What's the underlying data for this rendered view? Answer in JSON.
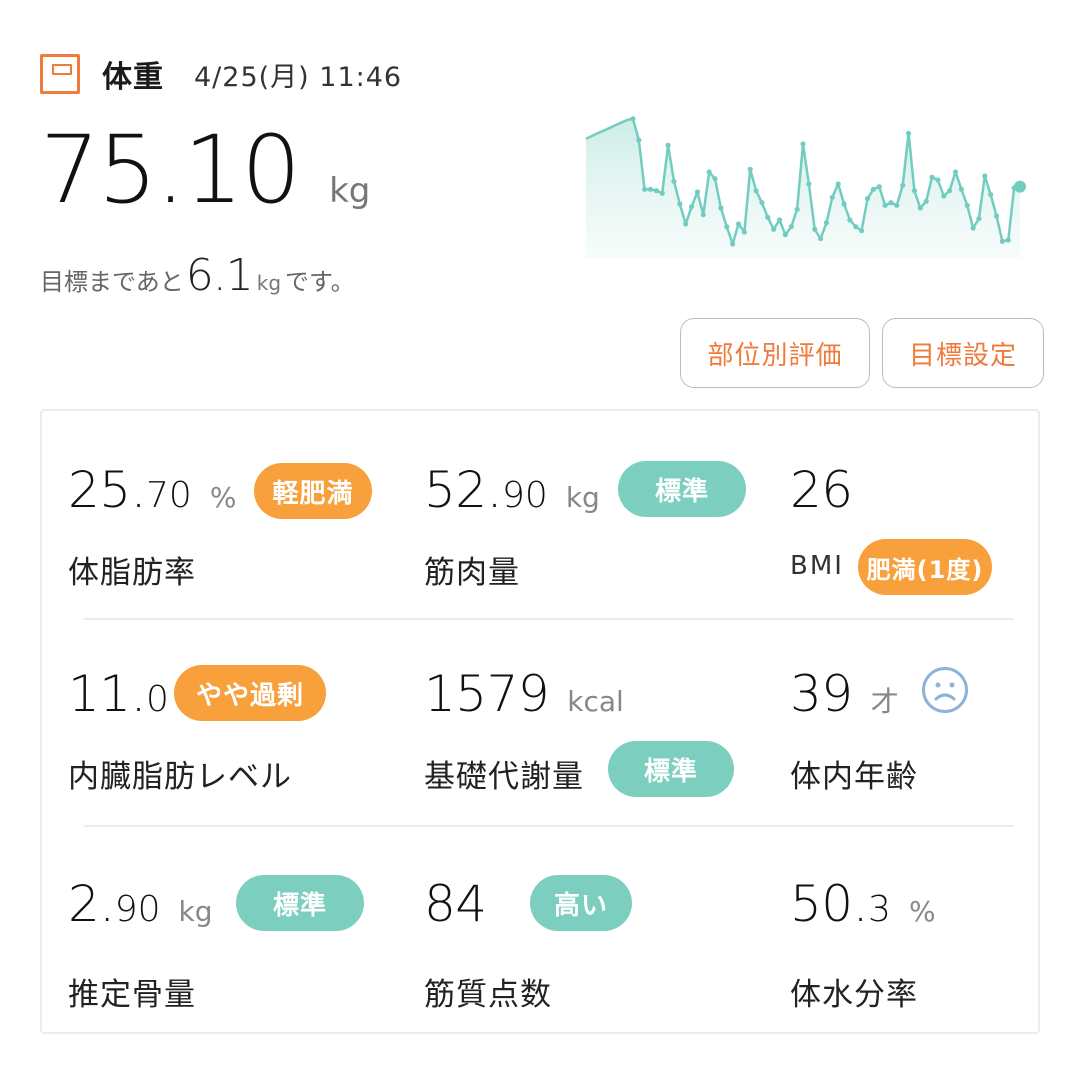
{
  "header": {
    "title": "体重",
    "date": "4/25(月) 11:46"
  },
  "weight": {
    "value": "75.10",
    "unit": "kg"
  },
  "goal": {
    "prefix": "目標まであと",
    "value": "6.1",
    "unit": "kg",
    "suffix": "です。"
  },
  "buttons": {
    "part_eval": "部位別評価",
    "goal_setting": "目標設定"
  },
  "colors": {
    "accent": "#f07a3a",
    "orange_badge": "#f7a03c",
    "teal_badge": "#7ccfbf",
    "line": "#72cdc0"
  },
  "metrics": [
    {
      "main": "25.",
      "dec": "70",
      "unit": "%",
      "label": "体脂肪率",
      "badge": "軽肥満",
      "badge_color": "orange"
    },
    {
      "main": "52.",
      "dec": "90",
      "unit": "kg",
      "label": "筋肉量",
      "badge": "標準",
      "badge_color": "teal"
    },
    {
      "main": "26",
      "dec": "",
      "unit": "",
      "label": "BMI",
      "badge": "肥満(1度)",
      "badge_color": "orange"
    },
    {
      "main": "11.",
      "dec": "0",
      "unit": "",
      "label": "内臓脂肪レベル",
      "badge": "やや過剰",
      "badge_color": "orange"
    },
    {
      "main": "1579",
      "dec": "",
      "unit": "kcal",
      "label": "基礎代謝量",
      "badge": "標準",
      "badge_color": "teal"
    },
    {
      "main": "39",
      "dec": "",
      "unit": "才",
      "label": "体内年齢",
      "icon": "sad-face-icon"
    },
    {
      "main": "2.",
      "dec": "90",
      "unit": "kg",
      "label": "推定骨量",
      "badge": "標準",
      "badge_color": "teal"
    },
    {
      "main": "84",
      "dec": "",
      "unit": "",
      "label": "筋質点数",
      "badge": "高い",
      "badge_color": "teal"
    },
    {
      "main": "50.",
      "dec": "3",
      "unit": "%",
      "label": "体水分率"
    }
  ],
  "chart_data": {
    "type": "area",
    "values": [
      80.2,
      80.4,
      80.6,
      80.8,
      81.0,
      81.2,
      81.4,
      81.6,
      81.7,
      80.1,
      76.4,
      76.4,
      76.3,
      76.1,
      79.7,
      77.0,
      75.3,
      73.8,
      75.1,
      76.2,
      74.5,
      77.7,
      77.2,
      75.0,
      73.6,
      72.3,
      73.8,
      73.2,
      77.9,
      76.3,
      75.4,
      74.3,
      73.4,
      74.1,
      73.0,
      73.6,
      74.9,
      79.8,
      76.8,
      73.4,
      72.7,
      73.9,
      75.8,
      76.8,
      75.3,
      74.1,
      73.6,
      73.3,
      75.7,
      76.4,
      76.6,
      75.2,
      75.4,
      75.2,
      76.7,
      80.6,
      76.3,
      75.0,
      75.5,
      77.3,
      77.1,
      75.9,
      76.3,
      77.7,
      76.4,
      75.2,
      73.5,
      74.2,
      77.4,
      76.0,
      74.4,
      72.5,
      72.6,
      76.5,
      76.6
    ],
    "grid": false
  }
}
